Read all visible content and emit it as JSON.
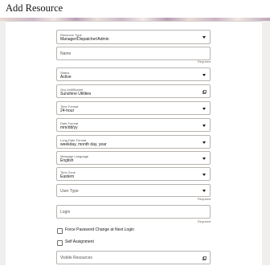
{
  "page": {
    "title": "Add Resource"
  },
  "form": {
    "resource_type": {
      "label": "Resource Type",
      "value": "Manager/Dispatcher/Admin"
    },
    "name": {
      "placeholder": "Name",
      "required": "Required"
    },
    "status": {
      "label": "Status",
      "value": "Active"
    },
    "org_unit": {
      "label": "Org Unit/Bucket",
      "value": "Sunshine Utilities"
    },
    "time_format": {
      "label": "Time Format",
      "value": "24-hour"
    },
    "date_format": {
      "label": "Date Format",
      "value": "mm/dd/yy"
    },
    "long_date_format": {
      "label": "Long Date Format",
      "value": "weekday, month day, year"
    },
    "message_language": {
      "label": "Message Language",
      "value": "English"
    },
    "time_zone": {
      "label": "Time Zone",
      "value": "Eastern"
    },
    "user_type": {
      "placeholder": "User Type",
      "required": "Required"
    },
    "login": {
      "placeholder": "Login",
      "required": "Required"
    },
    "force_password": {
      "label": "Force Password Change at Next Login"
    },
    "self_assignment": {
      "label": "Self Assignment"
    },
    "visible_resources": {
      "placeholder": "Visible Resources"
    }
  }
}
